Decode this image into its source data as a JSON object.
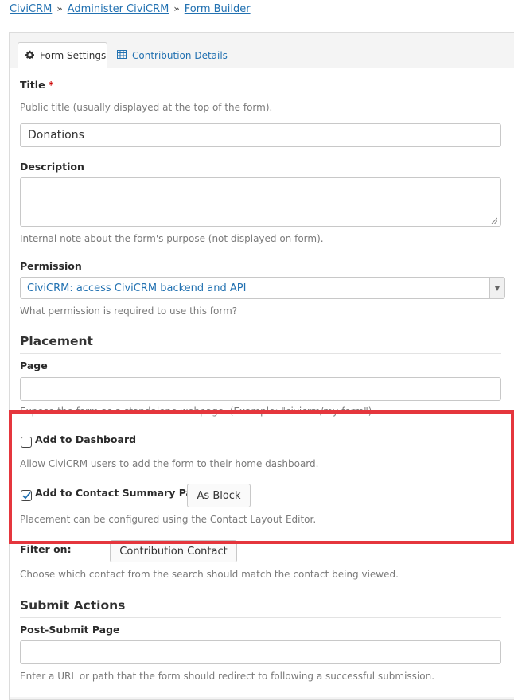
{
  "breadcrumb": {
    "items": [
      "CiviCRM",
      "Administer CiviCRM",
      "Form Builder"
    ],
    "separator": "»"
  },
  "tabs": [
    {
      "label": "Form Settings",
      "icon": "gear-icon",
      "active": true
    },
    {
      "label": "Contribution Details",
      "icon": "table-icon",
      "active": false
    }
  ],
  "form": {
    "title": {
      "label": "Title",
      "required_mark": "*",
      "help": "Public title (usually displayed at the top of the form).",
      "value": "Donations"
    },
    "description": {
      "label": "Description",
      "value": "",
      "help": "Internal note about the form's purpose (not displayed on form)."
    },
    "permission": {
      "label": "Permission",
      "value": "CiviCRM: access CiviCRM backend and API",
      "help": "What permission is required to use this form?"
    },
    "placement": {
      "heading": "Placement",
      "page": {
        "label": "Page",
        "value": "",
        "help": "Expose the form as a standalone webpage. (Example: \"civicrm/my-form\")"
      },
      "dashboard": {
        "label": "Add to Dashboard",
        "checked": false,
        "help": "Allow CiviCRM users to add the form to their home dashboard."
      },
      "contact_summary": {
        "label": "Add to Contact Summary Page",
        "checked": true,
        "button": "As Block",
        "help": "Placement can be configured using the Contact Layout Editor."
      },
      "filter_on": {
        "label": "Filter on:",
        "button": "Contribution Contact",
        "help": "Choose which contact from the search should match the contact being viewed."
      }
    },
    "submit_actions": {
      "heading": "Submit Actions",
      "post_submit": {
        "label": "Post-Submit Page",
        "value": "",
        "help": "Enter a URL or path that the form should redirect to following a successful submission."
      }
    }
  },
  "colors": {
    "link": "#2271b1",
    "highlight": "#e5363d"
  }
}
